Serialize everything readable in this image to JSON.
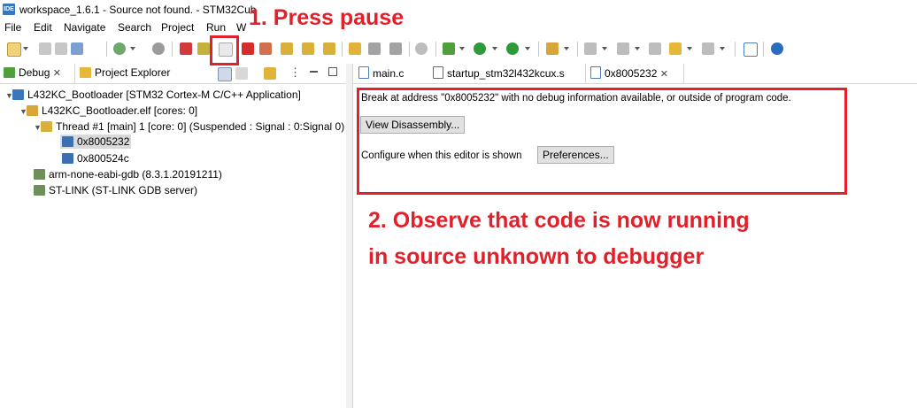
{
  "window": {
    "title": "workspace_1.6.1 - Source not found. - STM32Cub",
    "logo": "IDE"
  },
  "menu": [
    "File",
    "Edit",
    "Navigate",
    "Search",
    "Project",
    "Run",
    "W"
  ],
  "left_tabs": [
    {
      "label": "Debug",
      "icon": "debug-bug-icon"
    },
    {
      "label": "Project Explorer",
      "icon": "project-explorer-icon"
    }
  ],
  "debug_tree": [
    {
      "label": "L432KC_Bootloader [STM32 Cortex-M C/C++ Application]",
      "icon": "ide-launch-icon"
    },
    {
      "label": "L432KC_Bootloader.elf [cores: 0]",
      "icon": "elf-process-icon"
    },
    {
      "label": "Thread #1 [main] 1 [core: 0] (Suspended : Signal : 0:Signal 0)",
      "icon": "thread-icon"
    },
    {
      "label": "0x8005232",
      "icon": "stack-frame-icon"
    },
    {
      "label": "0x800524c",
      "icon": "stack-frame-icon"
    },
    {
      "label": "arm-none-eabi-gdb (8.3.1.20191211)",
      "icon": "gdb-process-icon"
    },
    {
      "label": "ST-LINK (ST-LINK GDB server)",
      "icon": "gdb-server-icon"
    }
  ],
  "editor_tabs": [
    {
      "label": "main.c",
      "icon": "c-file-icon"
    },
    {
      "label": "startup_stm32l432kcux.s",
      "icon": "asm-file-icon"
    },
    {
      "label": "0x8005232",
      "icon": "c-file-icon"
    }
  ],
  "editor": {
    "message": "Break at address \"0x8005232\" with no debug information available, or outside of program code.",
    "view_disassembly": "View Disassembly...",
    "configure_text": "Configure when this editor is shown",
    "preferences": "Preferences..."
  },
  "annotations": {
    "step1": "1. Press pause",
    "step2_line1": "2. Observe that code is now running",
    "step2_line2": "in source unknown to debugger",
    "color": "#e3202a"
  },
  "colors": {
    "accent_blue": "#3a76bd",
    "annotation_red": "#e3202a"
  }
}
